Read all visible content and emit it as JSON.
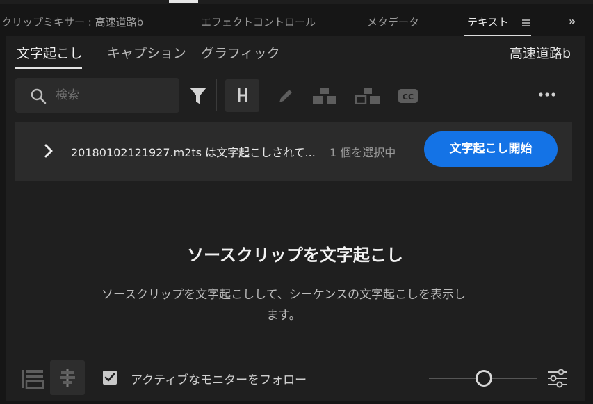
{
  "panel_tabs": [
    {
      "label": "クリップミキサー : 高速道路b"
    },
    {
      "label": "エフェクトコントロール"
    },
    {
      "label": "メタデータ"
    },
    {
      "label": "テキスト"
    }
  ],
  "subtabs": [
    {
      "label": "文字起こし"
    },
    {
      "label": "キャプション"
    },
    {
      "label": "グラフィック"
    }
  ],
  "sequence_name": "高速道路b",
  "search": {
    "placeholder": "検索",
    "value": ""
  },
  "toolbar_icons": [
    "filter-icon",
    "merge-segments-icon",
    "edit-icon",
    "split-speaker-icon",
    "speaker-icon",
    "cc-icon",
    "more-icon"
  ],
  "info_bar": {
    "file_text": "20180102121927.m2ts は文字起こしされて...",
    "selection_text": "1 個を選択中",
    "start_button": "文字起こし開始"
  },
  "empty_state": {
    "title": "ソースクリップを文字起こし",
    "description": "ソースクリップを文字起こしして、シーケンスの文字起こしを表示します。"
  },
  "footer": {
    "follow_label": "アクティブなモニターをフォロー",
    "follow_checked": true,
    "zoom_level": 0.4
  },
  "colors": {
    "accent": "#1473e6",
    "panel_bg": "#1f1f1f",
    "bar_bg": "#2b2b2b"
  }
}
